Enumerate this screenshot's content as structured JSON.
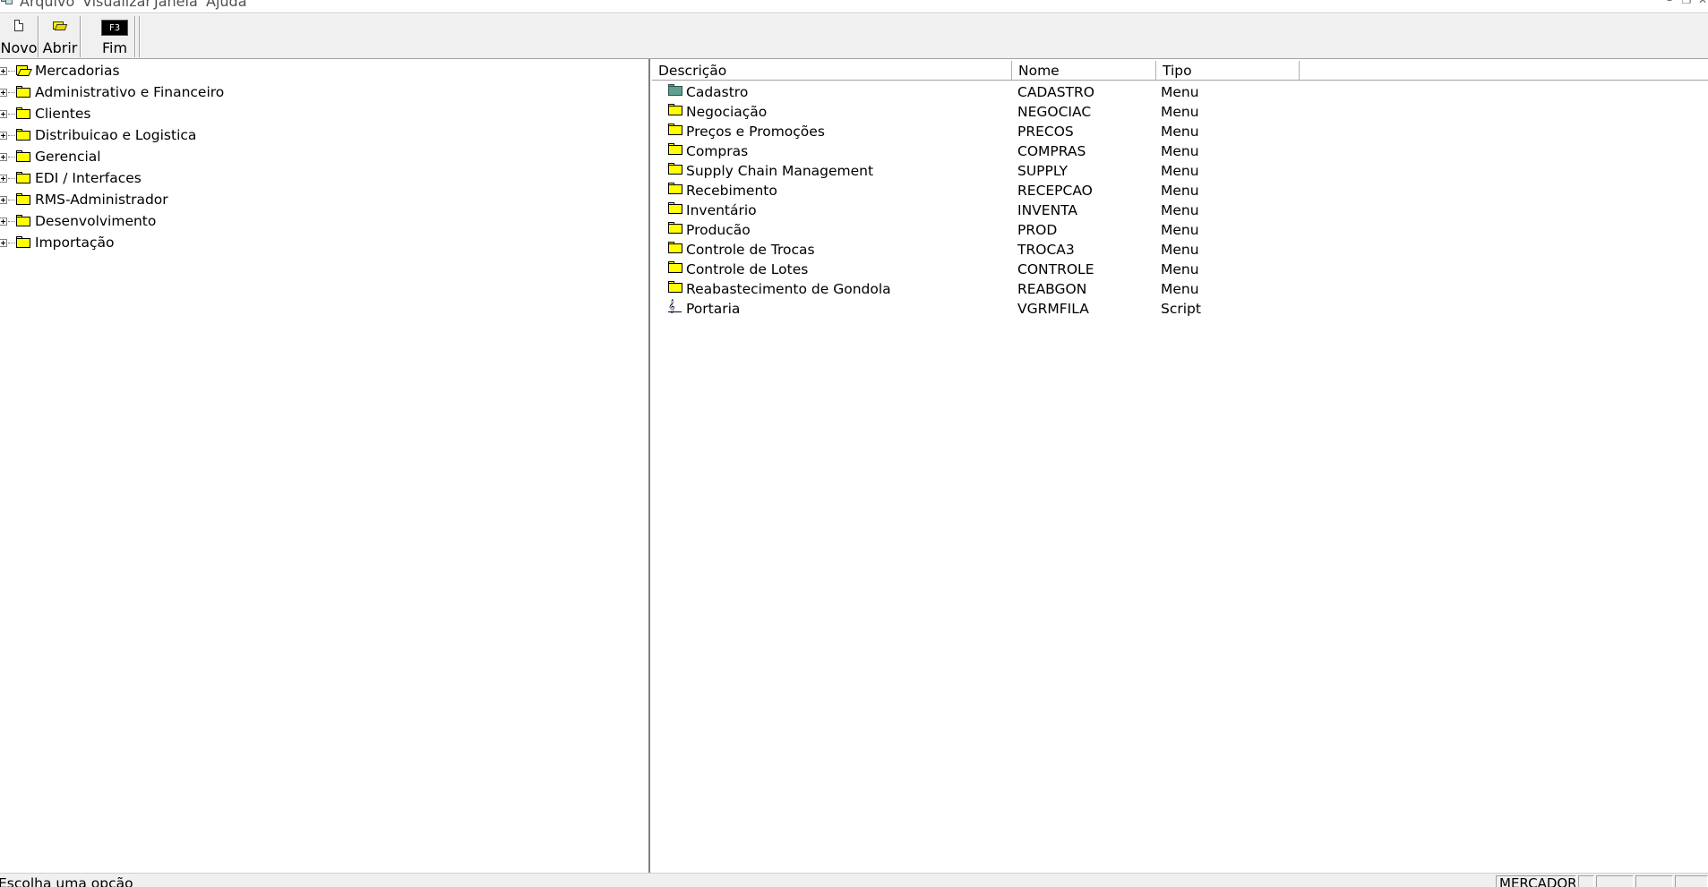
{
  "menubar": {
    "items": [
      "Arquivo",
      "Visualizar",
      "Janela",
      "Ajuda"
    ],
    "window_controls": [
      "–",
      "❐",
      "✕"
    ]
  },
  "toolbar": {
    "buttons": [
      {
        "label": "Novo",
        "icon": "new-document-icon"
      },
      {
        "label": "Abrir",
        "icon": "open-folder-icon"
      },
      {
        "label": "Fim",
        "icon": "f3-key-icon",
        "icon_text": "F3"
      }
    ]
  },
  "tree": {
    "items": [
      {
        "label": "Mercadorias",
        "icon": "open-folder-icon"
      },
      {
        "label": "Administrativo e Financeiro",
        "icon": "folder-icon"
      },
      {
        "label": "Clientes",
        "icon": "folder-icon"
      },
      {
        "label": "Distribuicao e Logistica",
        "icon": "folder-icon"
      },
      {
        "label": "Gerencial",
        "icon": "folder-icon"
      },
      {
        "label": "EDI / Interfaces",
        "icon": "folder-icon"
      },
      {
        "label": "RMS-Administrador",
        "icon": "folder-icon"
      },
      {
        "label": "Desenvolvimento",
        "icon": "folder-icon"
      },
      {
        "label": "Importação",
        "icon": "folder-icon"
      }
    ]
  },
  "list": {
    "columns": [
      "Descrição",
      "Nome",
      "Tipo"
    ],
    "rows": [
      {
        "descricao": "Cadastro",
        "nome": "CADASTRO",
        "tipo": "Menu",
        "icon": "folder-icon-green"
      },
      {
        "descricao": "Negociação",
        "nome": "NEGOCIAC",
        "tipo": "Menu",
        "icon": "folder-icon"
      },
      {
        "descricao": "Preços e Promoções",
        "nome": "PRECOS",
        "tipo": "Menu",
        "icon": "folder-icon"
      },
      {
        "descricao": "Compras",
        "nome": "COMPRAS",
        "tipo": "Menu",
        "icon": "folder-icon"
      },
      {
        "descricao": "Supply Chain Management",
        "nome": "SUPPLY",
        "tipo": "Menu",
        "icon": "folder-icon"
      },
      {
        "descricao": "Recebimento",
        "nome": "RECEPCAO",
        "tipo": "Menu",
        "icon": "folder-icon"
      },
      {
        "descricao": "Inventário",
        "nome": "INVENTA",
        "tipo": "Menu",
        "icon": "folder-icon"
      },
      {
        "descricao": "Producão",
        "nome": "PROD",
        "tipo": "Menu",
        "icon": "folder-icon"
      },
      {
        "descricao": "Controle de Trocas",
        "nome": "TROCA3",
        "tipo": "Menu",
        "icon": "folder-icon"
      },
      {
        "descricao": "Controle de Lotes",
        "nome": "CONTROLE",
        "tipo": "Menu",
        "icon": "folder-icon"
      },
      {
        "descricao": "Reabastecimento de Gondola",
        "nome": "REABGON",
        "tipo": "Menu",
        "icon": "folder-icon"
      },
      {
        "descricao": "Portaria",
        "nome": "VGRMFILA",
        "tipo": "Script",
        "icon": "script-icon"
      }
    ]
  },
  "statusbar": {
    "message": "Escolha uma opção",
    "panels": [
      "MERCADOR",
      "",
      "",
      "",
      ""
    ]
  }
}
